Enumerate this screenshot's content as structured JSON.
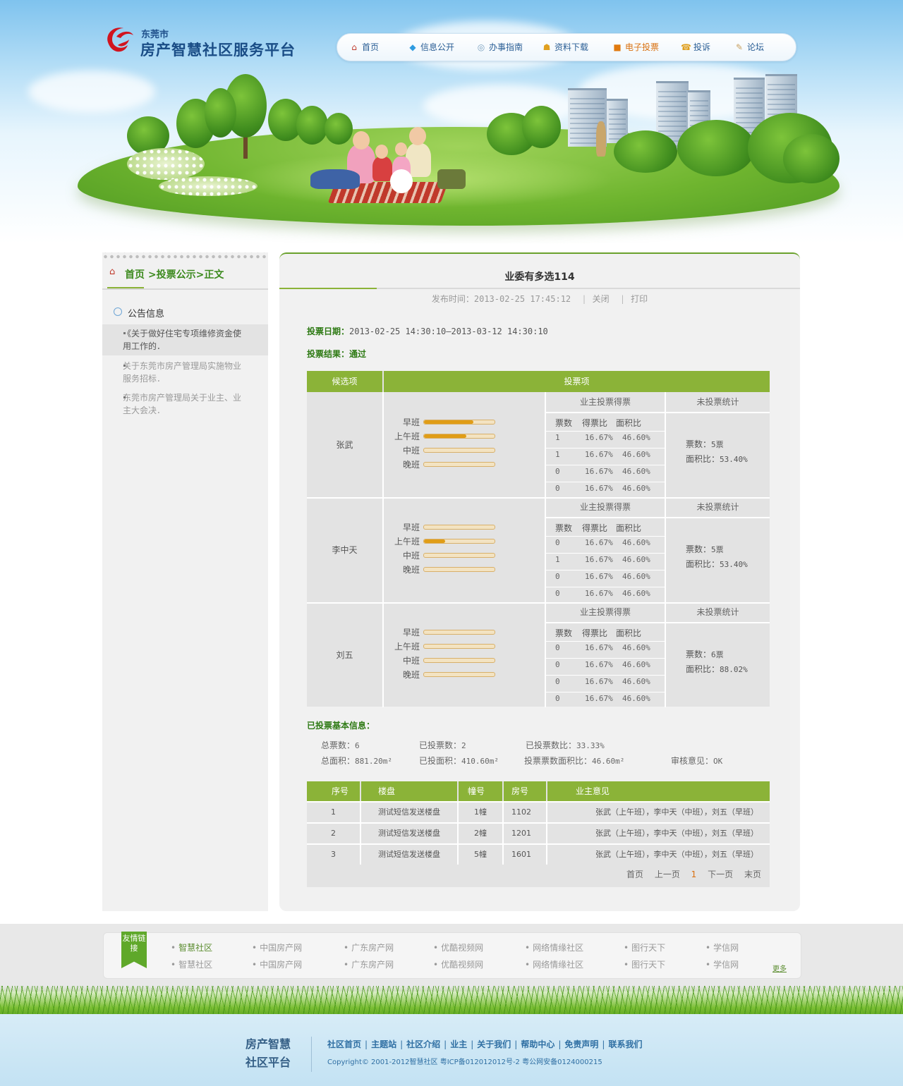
{
  "header": {
    "logo_small": "东莞市",
    "logo_big": "房产智慧社区服务平台"
  },
  "nav": [
    {
      "label": "首页",
      "icon": "home-icon"
    },
    {
      "label": "信息公开",
      "icon": "diamond-icon"
    },
    {
      "label": "办事指南",
      "icon": "compass-icon"
    },
    {
      "label": "资料下载",
      "icon": "download-icon"
    },
    {
      "label": "电子投票",
      "icon": "ballot-icon"
    },
    {
      "label": "投诉",
      "icon": "phone-icon"
    },
    {
      "label": "论坛",
      "icon": "forum-icon"
    }
  ],
  "sidebar": {
    "breadcrumb": "首页 >投票公示>正文",
    "notice_title": "公告信息",
    "news": [
      "《关于做好住宅专项维修资金使用工作的．",
      "关于东莞市房产管理局实施物业服务招标．",
      "东莞市房产管理局关于业主、业主大会决．"
    ]
  },
  "article": {
    "title": "业委有多选114",
    "publish_label": "发布时间：",
    "publish_time": "2013-02-25 17:45:12",
    "close": "关闭",
    "print": "打印",
    "vote_date_label": "投票日期：",
    "vote_date": "2013-02-25 14:30:10—2013-03-12 14:30:10",
    "vote_result_label": "投票结果：",
    "vote_result": "通过"
  },
  "vote_table": {
    "head_candidate": "候选项",
    "head_items": "投票项",
    "sub_owner": "业主投票得票",
    "sub_unvoted": "未投票统计",
    "col_votes": "票数",
    "col_ratio": "得票比",
    "col_area": "面积比",
    "slot_labels": [
      "早班",
      "上午班",
      "中班",
      "晚班"
    ],
    "candidates": [
      {
        "name": "张武",
        "bars": [
          0.7,
          0.6,
          0,
          0
        ],
        "rows": [
          {
            "votes": "1",
            "ratio": "16.67%",
            "area": "46.60%"
          },
          {
            "votes": "1",
            "ratio": "16.67%",
            "area": "46.60%"
          },
          {
            "votes": "0",
            "ratio": "16.67%",
            "area": "46.60%"
          },
          {
            "votes": "0",
            "ratio": "16.67%",
            "area": "46.60%"
          }
        ],
        "unvoted_votes_label": "票数：",
        "unvoted_votes": "5票",
        "unvoted_area_label": "面积比：",
        "unvoted_area": "53.40%"
      },
      {
        "name": "李中天",
        "bars": [
          0,
          0.3,
          0,
          0
        ],
        "rows": [
          {
            "votes": "0",
            "ratio": "16.67%",
            "area": "46.60%"
          },
          {
            "votes": "1",
            "ratio": "16.67%",
            "area": "46.60%"
          },
          {
            "votes": "0",
            "ratio": "16.67%",
            "area": "46.60%"
          },
          {
            "votes": "0",
            "ratio": "16.67%",
            "area": "46.60%"
          }
        ],
        "unvoted_votes_label": "票数：",
        "unvoted_votes": "5票",
        "unvoted_area_label": "面积比：",
        "unvoted_area": "53.40%"
      },
      {
        "name": "刘五",
        "bars": [
          0,
          0,
          0,
          0
        ],
        "rows": [
          {
            "votes": "0",
            "ratio": "16.67%",
            "area": "46.60%"
          },
          {
            "votes": "0",
            "ratio": "16.67%",
            "area": "46.60%"
          },
          {
            "votes": "0",
            "ratio": "16.67%",
            "area": "46.60%"
          },
          {
            "votes": "0",
            "ratio": "16.67%",
            "area": "46.60%"
          }
        ],
        "unvoted_votes_label": "票数：",
        "unvoted_votes": "6票",
        "unvoted_area_label": "面积比：",
        "unvoted_area": "88.02%"
      }
    ]
  },
  "summary": {
    "title": "已投票基本信息：",
    "total_votes_label": "总票数：",
    "total_votes": "6",
    "voted_label": "已投票数：",
    "voted": "2",
    "voted_ratio_label": "已投票数比：",
    "voted_ratio": "33.33%",
    "total_area_label": "总面积：",
    "total_area": "881.20m²",
    "voted_area_label": "已投面积：",
    "voted_area": "410.60m²",
    "voted_area_ratio_label": "投票票数面积比：",
    "voted_area_ratio": "46.60m²",
    "review_label": "审核意见：",
    "review": "OK"
  },
  "opinion_table": {
    "headers": [
      "序号",
      "楼盘",
      "幢号",
      "房号",
      "业主意见"
    ],
    "rows": [
      [
        "1",
        "测试短信发送楼盘",
        "1幢",
        "1102",
        "张武（上午班），李中天（中班），刘五（早班）"
      ],
      [
        "2",
        "测试短信发送楼盘",
        "2幢",
        "1201",
        "张武（上午班），李中天（中班），刘五（早班）"
      ],
      [
        "3",
        "测试短信发送楼盘",
        "5幢",
        "1601",
        "张武（上午班），李中天（中班），刘五（早班）"
      ]
    ]
  },
  "pager": {
    "first": "首页",
    "prev": "上一页",
    "current": "1",
    "next": "下一页",
    "last": "末页"
  },
  "links": {
    "ribbon": "友情链接",
    "row1": [
      "智慧社区",
      "中国房产网",
      "广东房产网",
      "优酷视频网",
      "网络情缘社区",
      "图行天下",
      "学信网"
    ],
    "row2": [
      "智慧社区",
      "中国房产网",
      "广东房产网",
      "优酷视频网",
      "网络情缘社区",
      "图行天下",
      "学信网"
    ],
    "more": "更多"
  },
  "footer": {
    "logo_line1": "房产智慧",
    "logo_line2": "社区平台",
    "links": [
      "社区首页",
      "主题站",
      "社区介绍",
      "业主",
      "关于我们",
      "帮助中心",
      "免责声明",
      "联系我们"
    ],
    "copyright": "Copyright© 2001-2012智慧社区 粤ICP备012012012号-2 粤公网安备0124000215"
  },
  "colors": {
    "accent_green": "#8bb338",
    "nav_blue": "#2a5e95",
    "highlight_orange": "#e09d17"
  }
}
